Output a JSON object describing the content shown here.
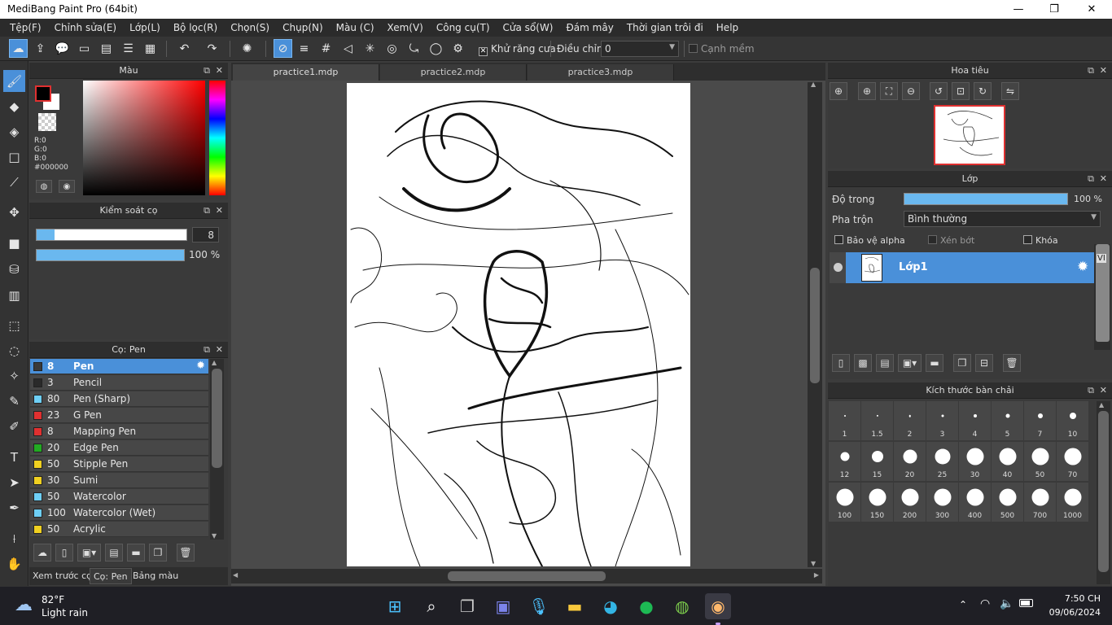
{
  "window": {
    "title": "MediBang Paint Pro (64bit)",
    "minimize": "—",
    "maximize": "❐",
    "close": "✕"
  },
  "menu": [
    "Tệp(F)",
    "Chỉnh sửa(E)",
    "Lớp(L)",
    "Bộ lọc(R)",
    "Chọn(S)",
    "Chụp(N)",
    "Màu (C)",
    "Xem(V)",
    "Công cụ(T)",
    "Cửa sổ(W)",
    "Đám mây",
    "Thời gian trôi đi",
    "Help"
  ],
  "toolbar": {
    "antialias_label": "Khử răng cưa",
    "correction_label": "Điều chỉnh",
    "correction_value": "0",
    "soft_edge_label": "Cạnh mềm"
  },
  "color_panel": {
    "title": "Màu",
    "r": "R:0",
    "g": "G:0",
    "b": "B:0",
    "hex": "#000000",
    "fg_color": "#000000",
    "bg_color": "#ffffff",
    "accent": "#e03030"
  },
  "brush_control": {
    "title": "Kiểm soát cọ",
    "size_value": "8",
    "size_fraction": 0.12,
    "opacity_value": "100 %",
    "opacity_fraction": 1.0
  },
  "brush_panel": {
    "title": "Cọ: Pen",
    "items": [
      {
        "size": "8",
        "name": "Pen",
        "color": "#3a3a3a",
        "selected": true
      },
      {
        "size": "3",
        "name": "Pencil",
        "color": "#2a2a2a"
      },
      {
        "size": "80",
        "name": "Pen (Sharp)",
        "color": "#6ecff6"
      },
      {
        "size": "23",
        "name": "G Pen",
        "color": "#e03030"
      },
      {
        "size": "8",
        "name": "Mapping Pen",
        "color": "#e03030"
      },
      {
        "size": "20",
        "name": "Edge Pen",
        "color": "#22aa22"
      },
      {
        "size": "50",
        "name": "Stipple Pen",
        "color": "#f0d020"
      },
      {
        "size": "30",
        "name": "Sumi",
        "color": "#f0d020"
      },
      {
        "size": "50",
        "name": "Watercolor",
        "color": "#6ecff6"
      },
      {
        "size": "100",
        "name": "Watercolor (Wet)",
        "color": "#6ecff6"
      },
      {
        "size": "50",
        "name": "Acrylic",
        "color": "#f0d020"
      }
    ]
  },
  "bottom_tabs": [
    "Xem trước cọ",
    "Cọ: Pen",
    "Bảng màu"
  ],
  "doc_tabs": [
    "practice1.mdp",
    "practice2.mdp",
    "practice3.mdp"
  ],
  "navigator": {
    "title": "Hoa tiêu"
  },
  "layers": {
    "title": "Lớp",
    "opacity_label": "Độ trong",
    "opacity_value": "100 %",
    "opacity_fraction": 1.0,
    "blend_label": "Pha trộn",
    "blend_value": "Bình thường",
    "protect_alpha": "Bảo vệ alpha",
    "clipping": "Xén bớt",
    "lock": "Khóa",
    "layer_name": "Lớp1",
    "side_tab": "VI"
  },
  "brush_size_panel": {
    "title": "Kích thước bàn chải",
    "sizes": [
      "1",
      "1.5",
      "2",
      "3",
      "4",
      "5",
      "7",
      "10",
      "12",
      "15",
      "20",
      "25",
      "30",
      "40",
      "50",
      "70",
      "100",
      "150",
      "200",
      "300",
      "400",
      "500",
      "700",
      "1000"
    ]
  },
  "taskbar": {
    "temp": "82°F",
    "weather": "Light rain",
    "time": "7:50 CH",
    "date": "09/06/2024"
  }
}
